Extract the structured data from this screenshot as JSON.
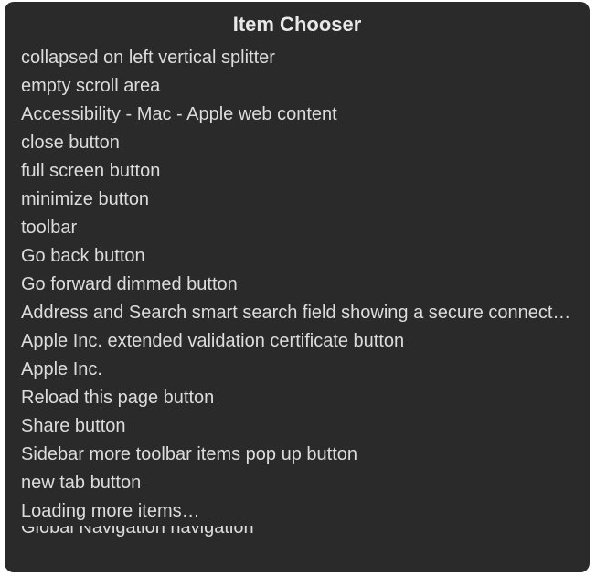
{
  "title": "Item Chooser",
  "items": [
    "collapsed on left vertical splitter",
    "empty scroll area",
    "Accessibility - Mac - Apple web content",
    "close button",
    "full screen button",
    "minimize button",
    "toolbar",
    "Go back button",
    "Go forward dimmed button",
    "Address and Search smart search field showing a secure connection",
    "Apple Inc. extended validation certificate button",
    "Apple Inc.",
    "Reload this page button",
    "Share button",
    "Sidebar more toolbar items pop up button",
    "new tab button",
    "Loading more items…",
    "Global Navigation navigation"
  ]
}
